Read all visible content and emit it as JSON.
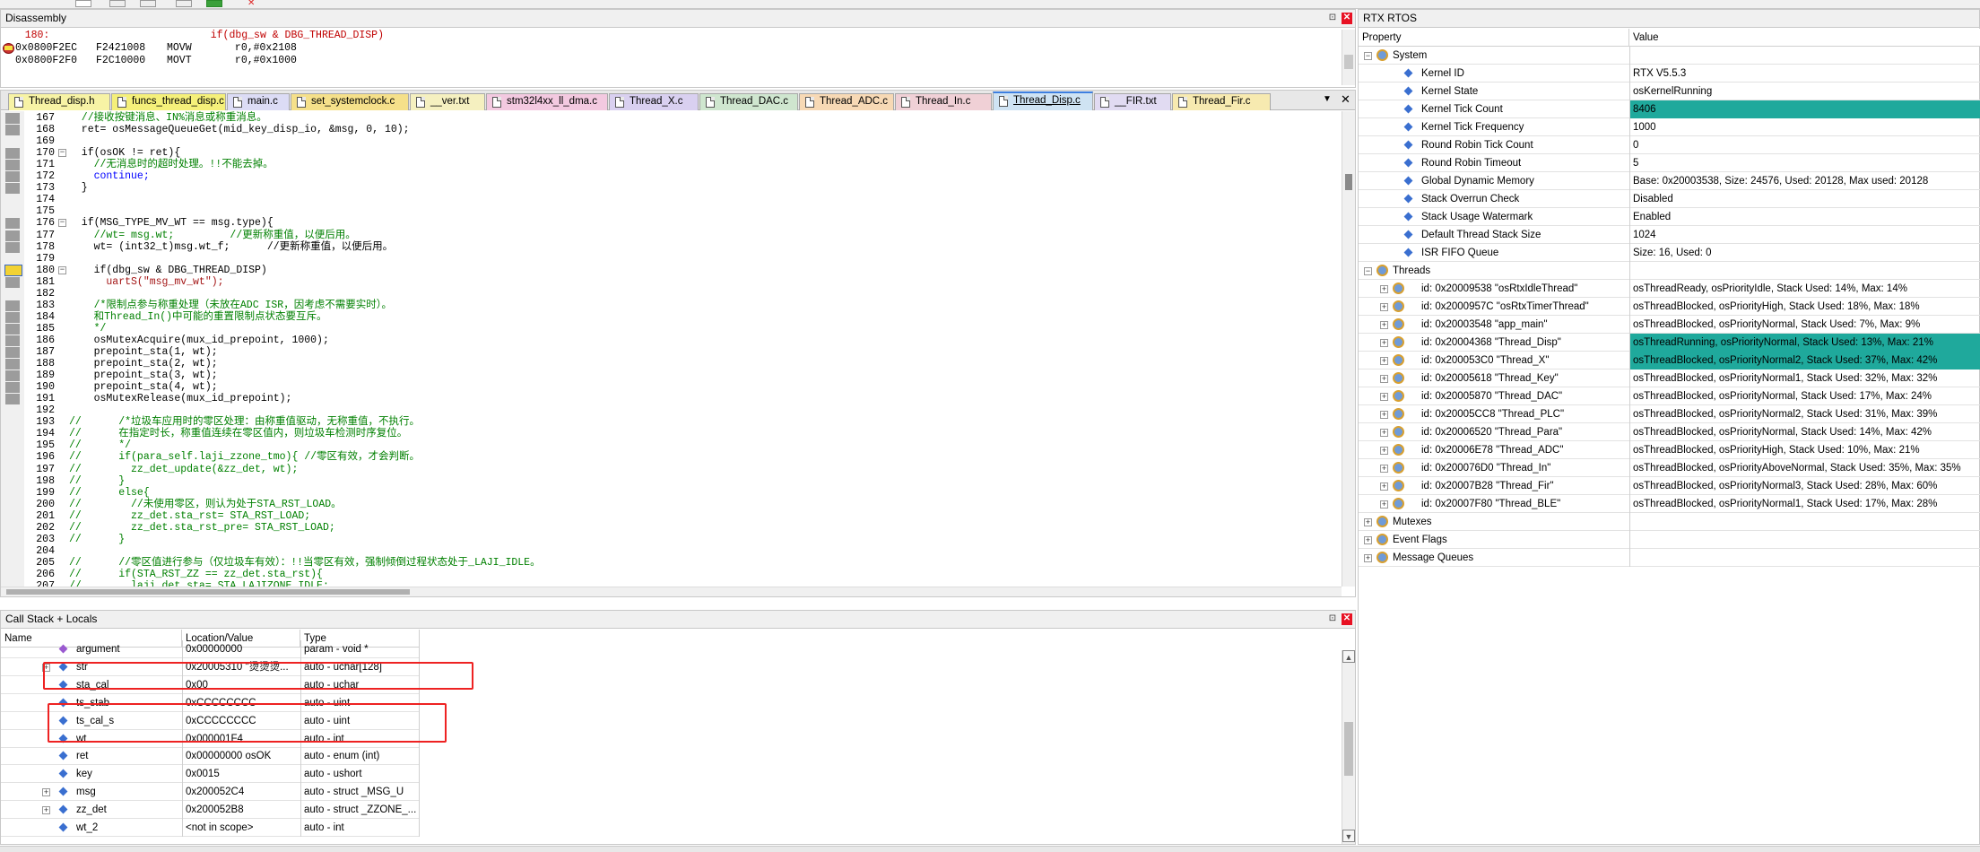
{
  "disassembly": {
    "title": "Disassembly",
    "lines": [
      {
        "addr": "",
        "hex": "",
        "text": "   180:                          if(dbg_sw & DBG_THREAD_DISP)"
      },
      {
        "addr": "0x0800F2EC",
        "hex": "F2421008",
        "text": "MOVW       r0,#0x2108"
      },
      {
        "addr": "0x0800F2F0",
        "hex": "F2C10000",
        "text": "MOVT       r0,#0x1000"
      }
    ]
  },
  "tabs": [
    {
      "label": "Thread_disp.h",
      "color": "#f7f3a5"
    },
    {
      "label": "funcs_thread_disp.c",
      "color": "#f5f07a"
    },
    {
      "label": "main.c",
      "color": "#dcdcf5"
    },
    {
      "label": "set_systemclock.c",
      "color": "#f5e08a"
    },
    {
      "label": "__ver.txt",
      "color": "#f5f0c0"
    },
    {
      "label": "stm32l4xx_ll_dma.c",
      "color": "#f3c9e0"
    },
    {
      "label": "Thread_X.c",
      "color": "#d9d0f0"
    },
    {
      "label": "Thread_DAC.c",
      "color": "#cfe6cf"
    },
    {
      "label": "Thread_ADC.c",
      "color": "#f7d9b5"
    },
    {
      "label": "Thread_In.c",
      "color": "#f0d0d6"
    },
    {
      "label": "Thread_Disp.c",
      "color": "#cfe3f3"
    },
    {
      "label": "__FIR.txt",
      "color": "#e1dbf2"
    },
    {
      "label": "Thread_Fir.c",
      "color": "#f7eab0"
    }
  ],
  "code": [
    {
      "n": "167",
      "t": "  //接收按键消息、IN%消息或称重消息。",
      "k": "c"
    },
    {
      "n": "168",
      "t": "  ret= osMessageQueueGet(mid_key_disp_io, &msg, 0, 10);",
      "k": "n"
    },
    {
      "n": "169",
      "t": "",
      "k": "n"
    },
    {
      "n": "170",
      "t": "  if(osOK != ret){",
      "k": "n"
    },
    {
      "n": "171",
      "t": "    //无消息时的超时处理。!!不能去掉。",
      "k": "c"
    },
    {
      "n": "172",
      "t": "    continue;",
      "k": "kw"
    },
    {
      "n": "173",
      "t": "  }",
      "k": "n"
    },
    {
      "n": "174",
      "t": "",
      "k": "n"
    },
    {
      "n": "175",
      "t": "",
      "k": "n"
    },
    {
      "n": "176",
      "t": "  if(MSG_TYPE_MV_WT == msg.type){",
      "k": "n"
    },
    {
      "n": "177",
      "t": "    //wt= msg.wt;         //更新称重值，以便后用。",
      "k": "c"
    },
    {
      "n": "178",
      "t": "    wt= (int32_t)msg.wt_f;      //更新称重值，以便后用。",
      "k": "nc"
    },
    {
      "n": "179",
      "t": "",
      "k": "n"
    },
    {
      "n": "180",
      "t": "    if(dbg_sw & DBG_THREAD_DISP)",
      "k": "n"
    },
    {
      "n": "181",
      "t": "      uartS(\"msg_mv_wt\");",
      "k": "s"
    },
    {
      "n": "182",
      "t": "",
      "k": "n"
    },
    {
      "n": "183",
      "t": "    /*限制点参与称重处理（未放在ADC ISR，因考虑不需要实时）。",
      "k": "c"
    },
    {
      "n": "184",
      "t": "    和Thread_In()中可能的重置限制点状态要互斥。",
      "k": "c"
    },
    {
      "n": "185",
      "t": "    */",
      "k": "c"
    },
    {
      "n": "186",
      "t": "    osMutexAcquire(mux_id_prepoint, 1000);",
      "k": "n"
    },
    {
      "n": "187",
      "t": "    prepoint_sta(1, wt);",
      "k": "n"
    },
    {
      "n": "188",
      "t": "    prepoint_sta(2, wt);",
      "k": "n"
    },
    {
      "n": "189",
      "t": "    prepoint_sta(3, wt);",
      "k": "n"
    },
    {
      "n": "190",
      "t": "    prepoint_sta(4, wt);",
      "k": "n"
    },
    {
      "n": "191",
      "t": "    osMutexRelease(mux_id_prepoint);",
      "k": "n"
    },
    {
      "n": "192",
      "t": "",
      "k": "n"
    },
    {
      "n": "193",
      "t": "//      /*垃圾车应用时的零区处理：由称重值驱动，无称重值，不执行。",
      "k": "c"
    },
    {
      "n": "194",
      "t": "//      在指定时长，称重值连续在零区值内，则垃圾车检测时序复位。",
      "k": "c"
    },
    {
      "n": "195",
      "t": "//      */",
      "k": "c"
    },
    {
      "n": "196",
      "t": "//      if(para_self.laji_zzone_tmo){ //零区有效，才会判断。",
      "k": "c"
    },
    {
      "n": "197",
      "t": "//        zz_det_update(&zz_det, wt);",
      "k": "c"
    },
    {
      "n": "198",
      "t": "//      }",
      "k": "c"
    },
    {
      "n": "199",
      "t": "//      else{",
      "k": "c"
    },
    {
      "n": "200",
      "t": "//        //未使用零区，则认为处于STA_RST_LOAD。",
      "k": "c"
    },
    {
      "n": "201",
      "t": "//        zz_det.sta_rst= STA_RST_LOAD;",
      "k": "c"
    },
    {
      "n": "202",
      "t": "//        zz_det.sta_rst_pre= STA_RST_LOAD;",
      "k": "c"
    },
    {
      "n": "203",
      "t": "//      }",
      "k": "c"
    },
    {
      "n": "204",
      "t": "",
      "k": "n"
    },
    {
      "n": "205",
      "t": "//      //零区值进行参与（仅垃圾车有效）：!!当零区有效，强制倾倒过程状态处于_LAJI_IDLE。",
      "k": "c"
    },
    {
      "n": "206",
      "t": "//      if(STA_RST_ZZ == zz_det.sta_rst){",
      "k": "c"
    },
    {
      "n": "207",
      "t": "//        laji_det.sta= STA_LAJIZONE_IDLE;",
      "k": "c"
    }
  ],
  "callstack": {
    "title": "Call Stack + Locals",
    "headers": {
      "name": "Name",
      "value": "Location/Value",
      "type": "Type"
    },
    "rows": [
      {
        "name": "argument",
        "value": "0x00000000",
        "type": "param - void *",
        "expand": false,
        "icon": "param"
      },
      {
        "name": "str",
        "value": "0x20005310 \"烫烫烫...",
        "type": "auto - uchar[128]",
        "expand": true,
        "icon": "var"
      },
      {
        "name": "sta_cal",
        "value": "0x00",
        "type": "auto - uchar",
        "expand": false,
        "icon": "var"
      },
      {
        "name": "ts_stab",
        "value": "0xCCCCCCCC",
        "type": "auto - uint",
        "expand": false,
        "icon": "var"
      },
      {
        "name": "ts_cal_s",
        "value": "0xCCCCCCCC",
        "type": "auto - uint",
        "expand": false,
        "icon": "var"
      },
      {
        "name": "wt",
        "value": "0x000001F4",
        "type": "auto - int",
        "expand": false,
        "icon": "var"
      },
      {
        "name": "ret",
        "value": "0x00000000 osOK",
        "type": "auto - enum (int)",
        "expand": false,
        "icon": "var"
      },
      {
        "name": "key",
        "value": "0x0015",
        "type": "auto - ushort",
        "expand": false,
        "icon": "var"
      },
      {
        "name": "msg",
        "value": "0x200052C4",
        "type": "auto - struct _MSG_U",
        "expand": true,
        "icon": "var"
      },
      {
        "name": "zz_det",
        "value": "0x200052B8",
        "type": "auto - struct _ZZONE_...",
        "expand": true,
        "icon": "var"
      },
      {
        "name": "wt_2",
        "value": "<not in scope>",
        "type": "auto - int",
        "expand": false,
        "icon": "var"
      }
    ]
  },
  "rtx": {
    "title": "RTX RTOS",
    "headers": {
      "property": "Property",
      "value": "Value"
    },
    "rows": [
      {
        "level": 0,
        "label": "System",
        "value": "",
        "exp": "-",
        "icon": "gear",
        "hl": false
      },
      {
        "level": 1,
        "label": "Kernel ID",
        "value": "RTX V5.5.3",
        "exp": "",
        "icon": "diamond",
        "hl": false
      },
      {
        "level": 1,
        "label": "Kernel State",
        "value": "osKernelRunning",
        "exp": "",
        "icon": "diamond",
        "hl": false
      },
      {
        "level": 1,
        "label": "Kernel Tick Count",
        "value": "8406",
        "exp": "",
        "icon": "diamond",
        "hl": true
      },
      {
        "level": 1,
        "label": "Kernel Tick Frequency",
        "value": "1000",
        "exp": "",
        "icon": "diamond",
        "hl": false
      },
      {
        "level": 1,
        "label": "Round Robin Tick Count",
        "value": "0",
        "exp": "",
        "icon": "diamond",
        "hl": false
      },
      {
        "level": 1,
        "label": "Round Robin Timeout",
        "value": "5",
        "exp": "",
        "icon": "diamond",
        "hl": false
      },
      {
        "level": 1,
        "label": "Global Dynamic Memory",
        "value": "Base: 0x20003538, Size: 24576, Used: 20128, Max used: 20128",
        "exp": "",
        "icon": "diamond",
        "hl": false
      },
      {
        "level": 1,
        "label": "Stack Overrun Check",
        "value": "Disabled",
        "exp": "",
        "icon": "diamond",
        "hl": false
      },
      {
        "level": 1,
        "label": "Stack Usage Watermark",
        "value": "Enabled",
        "exp": "",
        "icon": "diamond",
        "hl": false
      },
      {
        "level": 1,
        "label": "Default Thread Stack Size",
        "value": "1024",
        "exp": "",
        "icon": "diamond",
        "hl": false
      },
      {
        "level": 1,
        "label": "ISR FIFO Queue",
        "value": "Size: 16, Used: 0",
        "exp": "",
        "icon": "diamond",
        "hl": false
      },
      {
        "level": 0,
        "label": "Threads",
        "value": "",
        "exp": "-",
        "icon": "gear",
        "hl": false
      },
      {
        "level": 1,
        "label": "id: 0x20009538 \"osRtxIdleThread\"",
        "value": "osThreadReady, osPriorityIdle, Stack Used: 14%, Max: 14%",
        "exp": "+",
        "icon": "gear",
        "hl": false
      },
      {
        "level": 1,
        "label": "id: 0x2000957C \"osRtxTimerThread\"",
        "value": "osThreadBlocked, osPriorityHigh, Stack Used: 18%, Max: 18%",
        "exp": "+",
        "icon": "gear",
        "hl": false
      },
      {
        "level": 1,
        "label": "id: 0x20003548 \"app_main\"",
        "value": "osThreadBlocked, osPriorityNormal, Stack Used: 7%, Max: 9%",
        "exp": "+",
        "icon": "gear",
        "hl": false
      },
      {
        "level": 1,
        "label": "id: 0x20004368 \"Thread_Disp\"",
        "value": "osThreadRunning, osPriorityNormal, Stack Used: 13%, Max: 21%",
        "exp": "+",
        "icon": "gear",
        "hl": true
      },
      {
        "level": 1,
        "label": "id: 0x200053C0 \"Thread_X\"",
        "value": "osThreadBlocked, osPriorityNormal2, Stack Used: 37%, Max: 42%",
        "exp": "+",
        "icon": "gear",
        "hl": true
      },
      {
        "level": 1,
        "label": "id: 0x20005618 \"Thread_Key\"",
        "value": "osThreadBlocked, osPriorityNormal1, Stack Used: 32%, Max: 32%",
        "exp": "+",
        "icon": "gear",
        "hl": false
      },
      {
        "level": 1,
        "label": "id: 0x20005870 \"Thread_DAC\"",
        "value": "osThreadBlocked, osPriorityNormal, Stack Used: 17%, Max: 24%",
        "exp": "+",
        "icon": "gear",
        "hl": false
      },
      {
        "level": 1,
        "label": "id: 0x20005CC8 \"Thread_PLC\"",
        "value": "osThreadBlocked, osPriorityNormal2, Stack Used: 31%, Max: 39%",
        "exp": "+",
        "icon": "gear",
        "hl": false
      },
      {
        "level": 1,
        "label": "id: 0x20006520 \"Thread_Para\"",
        "value": "osThreadBlocked, osPriorityNormal, Stack Used: 14%, Max: 42%",
        "exp": "+",
        "icon": "gear",
        "hl": false
      },
      {
        "level": 1,
        "label": "id: 0x20006E78 \"Thread_ADC\"",
        "value": "osThreadBlocked, osPriorityHigh, Stack Used: 10%, Max: 21%",
        "exp": "+",
        "icon": "gear",
        "hl": false
      },
      {
        "level": 1,
        "label": "id: 0x200076D0 \"Thread_In\"",
        "value": "osThreadBlocked, osPriorityAboveNormal, Stack Used: 35%, Max: 35%",
        "exp": "+",
        "icon": "gear",
        "hl": false
      },
      {
        "level": 1,
        "label": "id: 0x20007B28 \"Thread_Fir\"",
        "value": "osThreadBlocked, osPriorityNormal3, Stack Used: 28%, Max: 60%",
        "exp": "+",
        "icon": "gear",
        "hl": false
      },
      {
        "level": 1,
        "label": "id: 0x20007F80 \"Thread_BLE\"",
        "value": "osThreadBlocked, osPriorityNormal1, Stack Used: 17%, Max: 28%",
        "exp": "+",
        "icon": "gear",
        "hl": false
      },
      {
        "level": 0,
        "label": "Mutexes",
        "value": "",
        "exp": "+",
        "icon": "gear",
        "hl": false
      },
      {
        "level": 0,
        "label": "Event Flags",
        "value": "",
        "exp": "+",
        "icon": "gear",
        "hl": false
      },
      {
        "level": 0,
        "label": "Message Queues",
        "value": "",
        "exp": "+",
        "icon": "gear",
        "hl": false
      }
    ]
  },
  "colors": {
    "highlight": "#1fa99c",
    "annotation": "#ee2222",
    "active_tab": "#3d7fe0"
  }
}
